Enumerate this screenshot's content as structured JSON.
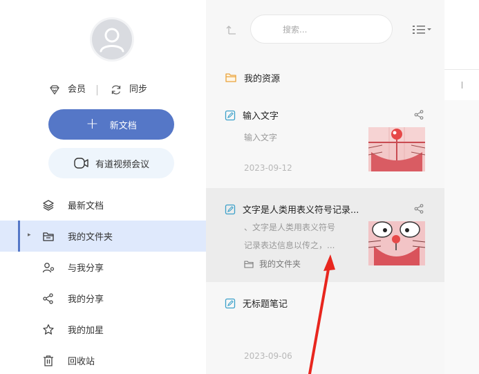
{
  "sidebar": {
    "vip_label": "会员",
    "sync_label": "同步",
    "new_doc_label": "新文档",
    "meeting_label": "有道视频会议",
    "nav": [
      {
        "label": "最新文档",
        "icon": "layers-icon"
      },
      {
        "label": "我的文件夹",
        "icon": "folder-icon",
        "active": true
      },
      {
        "label": "与我分享",
        "icon": "shared-with-me-icon"
      },
      {
        "label": "我的分享",
        "icon": "share-icon"
      },
      {
        "label": "我的加星",
        "icon": "star-icon"
      },
      {
        "label": "回收站",
        "icon": "trash-icon"
      }
    ]
  },
  "toolbar": {
    "search_placeholder": "搜索..."
  },
  "list": {
    "resource_label": "我的资源",
    "notes": [
      {
        "title": "输入文字",
        "snippet": "输入文字",
        "date": "2023-09-12"
      },
      {
        "title": "文字是人类用表义符号记录...",
        "snippet_line1": "、文字是人类用表义符号",
        "snippet_line2": "记录表达信息以传之，...",
        "folder": "我的文件夹"
      },
      {
        "title": "无标题笔记",
        "date": "2023-09-06"
      }
    ]
  },
  "colors": {
    "accent": "#5577c7",
    "active_bg": "#dfe9fc",
    "annotation_arrow": "#e8261e"
  }
}
